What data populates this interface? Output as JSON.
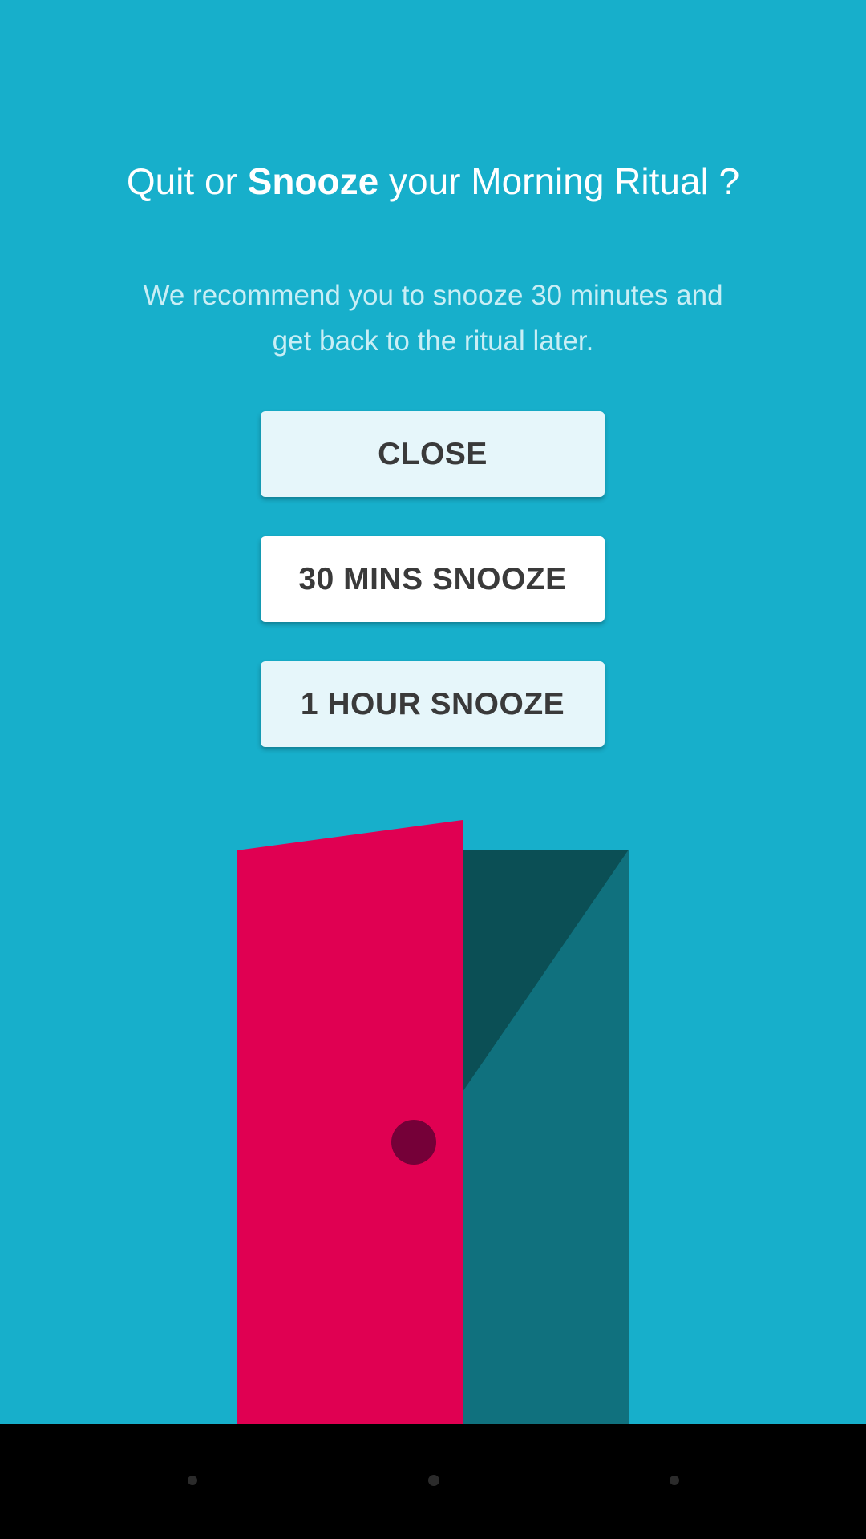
{
  "dialog": {
    "title_part1": "Quit or ",
    "title_bold": "Snooze",
    "title_part2": " your Morning Ritual ?",
    "subtitle": "We recommend you to snooze 30 minutes and get back to the ritual later."
  },
  "buttons": {
    "close_label": "CLOSE",
    "snooze30_label": "30 MINS SNOOZE",
    "snooze60_label": "1 HOUR SNOOZE"
  },
  "colors": {
    "background": "#17afcb",
    "door": "#e00052",
    "door_knob": "#750038",
    "door_frame_dark": "#0b4f55",
    "door_frame": "#10717e",
    "button_light": "#e6f6fa",
    "button_white": "#ffffff"
  },
  "navbar": {
    "buttons": [
      "back-button",
      "home-button",
      "recents-button"
    ]
  }
}
